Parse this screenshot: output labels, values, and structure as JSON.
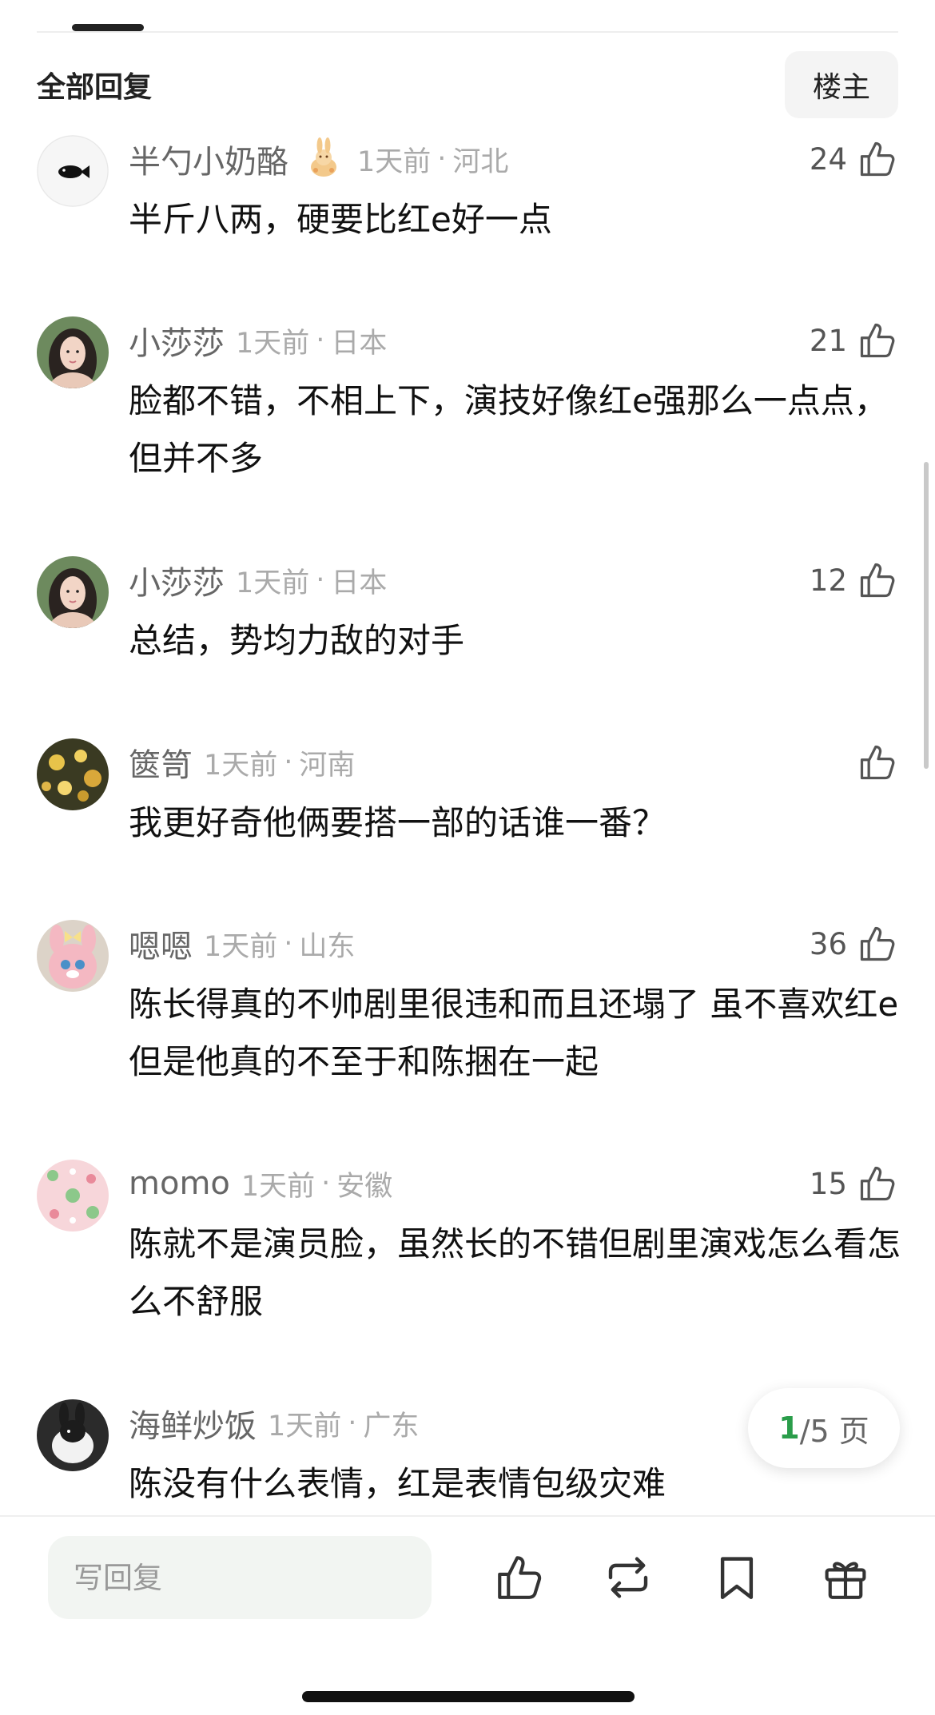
{
  "header": {
    "title": "全部回复",
    "op_filter": "楼主"
  },
  "comments": [
    {
      "username": "半勺小奶酪",
      "time": "1天前",
      "separator": "·",
      "region": "河北",
      "likes": "24",
      "text": "半斤八两，硬要比红e好一点",
      "avatar_icon": "fish-avatar-icon",
      "badge_icon": "rabbit-badge-icon"
    },
    {
      "username": "小莎莎",
      "time": "1天前",
      "separator": "·",
      "region": "日本",
      "likes": "21",
      "text": "脸都不错，不相上下，演技好像红e强那么一点点，但并不多",
      "avatar_icon": "portrait-avatar-icon"
    },
    {
      "username": "小莎莎",
      "time": "1天前",
      "separator": "·",
      "region": "日本",
      "likes": "12",
      "text": "总结，势均力敌的对手",
      "avatar_icon": "portrait-avatar-icon"
    },
    {
      "username": "篋笥",
      "time": "1天前",
      "separator": "·",
      "region": "河南",
      "likes": "",
      "text": "我更好奇他俩要搭一部的话谁一番？",
      "avatar_icon": "lantern-avatar-icon"
    },
    {
      "username": "嗯嗯",
      "time": "1天前",
      "separator": "·",
      "region": "山东",
      "likes": "36",
      "text": "陈长得真的不帅剧里很违和而且还塌了 虽不喜欢红e但是他真的不至于和陈捆在一起",
      "avatar_icon": "pink-bunny-avatar-icon"
    },
    {
      "username": "momo",
      "time": "1天前",
      "separator": "·",
      "region": "安徽",
      "likes": "15",
      "text": "陈就不是演员脸，虽然长的不错但剧里演戏怎么看怎么不舒服",
      "avatar_icon": "pink-pattern-avatar-icon"
    },
    {
      "username": "海鲜炒饭",
      "time": "1天前",
      "separator": "·",
      "region": "广东",
      "likes": "",
      "text": "陈没有什么表情，红是表情包级灾难",
      "avatar_icon": "rabbit-photo-avatar-icon"
    }
  ],
  "pager": {
    "current": "1",
    "rest": "/5 页"
  },
  "bottom_bar": {
    "reply_placeholder": "写回复",
    "actions": [
      "like-icon",
      "repost-icon",
      "bookmark-icon",
      "gift-icon"
    ]
  },
  "colors": {
    "accent_green": "#2a9d4a",
    "meta_gray": "#aaaaaa",
    "text": "#111111"
  }
}
